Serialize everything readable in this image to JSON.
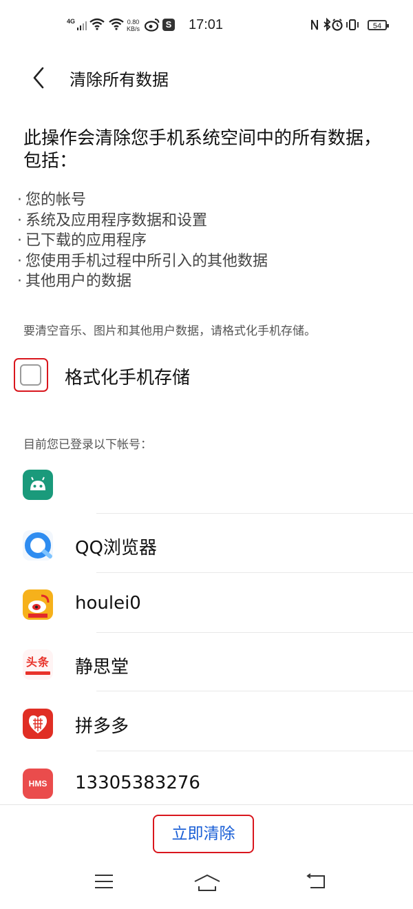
{
  "status_bar": {
    "network": "4G",
    "speed_value": "0.80",
    "speed_unit": "KB/s",
    "time": "17:01",
    "battery": "54"
  },
  "header": {
    "title": "清除所有数据"
  },
  "lead_text": "此操作会清除您手机系统空间中的所有数据，包括：",
  "bullets": [
    "您的帐号",
    "系统及应用程序数据和设置",
    "已下载的应用程序",
    "您使用手机过程中所引入的其他数据",
    "其他用户的数据"
  ],
  "hint": "要清空音乐、图片和其他用户数据，请格式化手机存储。",
  "format_option": {
    "label": "格式化手机存储",
    "checked": false
  },
  "accounts_header": "目前您已登录以下帐号：",
  "accounts": [
    {
      "label": "",
      "icon": "android-icon",
      "color": "#1a9a7b"
    },
    {
      "label": "QQ浏览器",
      "icon": "qq-browser-icon",
      "color": "#2e8cf0"
    },
    {
      "label": "houlei0",
      "icon": "weibo-icon",
      "color": "#f6b11b"
    },
    {
      "label": "静思堂",
      "icon": "toutiao-icon",
      "color": "#e8322a"
    },
    {
      "label": "拼多多",
      "icon": "pinduoduo-icon",
      "color": "#e02e24"
    },
    {
      "label": "13305383276",
      "icon": "hms-icon",
      "color": "#ea4c4c"
    }
  ],
  "toutiao_text": "头条",
  "hms_text": "HMS",
  "clear_button": "立即清除",
  "accent_color": "#d9161d"
}
